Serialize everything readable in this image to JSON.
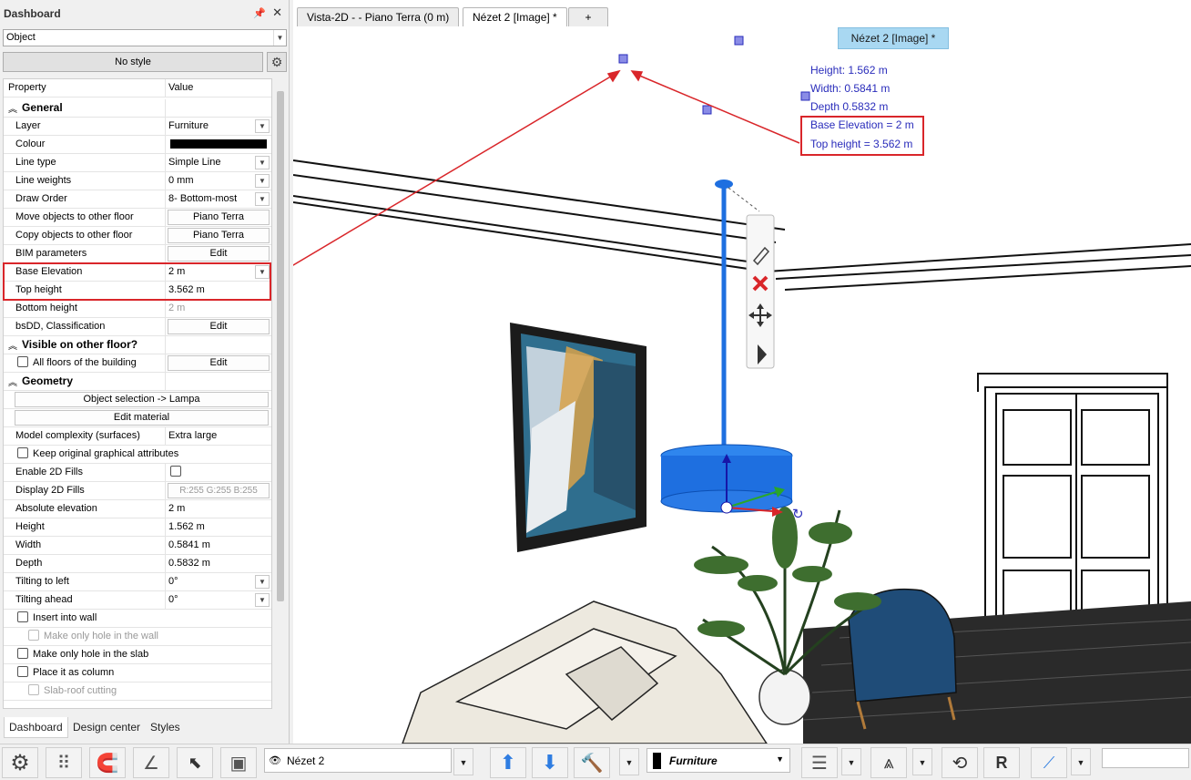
{
  "panel": {
    "title": "Dashboard",
    "selector": "Object",
    "style_button": "No style",
    "header": {
      "property": "Property",
      "value": "Value"
    },
    "sections": {
      "general": "General",
      "visible": "Visible on other floor?",
      "geometry": "Geometry"
    },
    "rows": {
      "layer": {
        "k": "Layer",
        "v": "Furniture"
      },
      "colour": {
        "k": "Colour"
      },
      "line_type": {
        "k": "Line type",
        "v": "Simple Line"
      },
      "line_weights": {
        "k": "Line weights",
        "v": "0 mm"
      },
      "draw_order": {
        "k": "Draw Order",
        "v": "8- Bottom-most"
      },
      "move_objects": {
        "k": "Move objects to other floor",
        "v": "Piano Terra"
      },
      "copy_objects": {
        "k": "Copy objects to other floor",
        "v": "Piano Terra"
      },
      "bim": {
        "k": "BIM parameters",
        "v": "Edit"
      },
      "base_elevation": {
        "k": "Base Elevation",
        "v": "2 m"
      },
      "top_height": {
        "k": "Top height",
        "v": "3.562 m"
      },
      "bottom_height": {
        "k": "Bottom height",
        "v": "2 m"
      },
      "bsdd": {
        "k": "bsDD, Classification",
        "v": "Edit"
      },
      "all_floors": {
        "k": "All floors of the building",
        "v": "Edit"
      },
      "object_selection": "Object selection -> Lampa",
      "edit_material": "Edit material",
      "model_complexity": {
        "k": "Model complexity (surfaces)",
        "v": "Extra large"
      },
      "keep_graphical": "Keep original graphical attributes",
      "enable_2d_fills": {
        "k": "Enable 2D Fills"
      },
      "display_2d_fills": {
        "k": "Display 2D Fills",
        "v": "R:255 G:255 B:255"
      },
      "absolute_elevation": {
        "k": "Absolute elevation",
        "v": "2 m"
      },
      "height": {
        "k": "Height",
        "v": "1.562 m"
      },
      "width": {
        "k": "Width",
        "v": "0.5841 m"
      },
      "depth": {
        "k": "Depth",
        "v": "0.5832 m"
      },
      "tilting_left": {
        "k": "Tilting to left",
        "v": "0°"
      },
      "tilting_ahead": {
        "k": "Tilting ahead",
        "v": "0°"
      },
      "insert_wall": "Insert into wall",
      "hole_wall": "Make only hole in the wall",
      "hole_slab": "Make only hole in the slab",
      "place_column": "Place it as column",
      "slab_roof": "Slab-roof cutting"
    },
    "tabs": [
      "Dashboard",
      "Design center",
      "Styles"
    ]
  },
  "doc_tabs": [
    "Vista-2D -  - Piano Terra (0 m)",
    "Nézet 2 [Image] *",
    "+"
  ],
  "view_label": "Nézet 2 [Image] *",
  "info": {
    "height": "Height: 1.562 m",
    "width": "Width: 0.5841 m",
    "depth": "Depth 0.5832 m",
    "base_elevation": "Base Elevation = 2 m",
    "top_height": "Top height = 3.562 m"
  },
  "toolbar": {
    "view_select": "Nézet 2",
    "layer_select": "Furniture"
  },
  "colors": {
    "highlight_red": "#d9262a",
    "info_blue": "#2a2dbb",
    "lamp_blue": "#1e6fe0",
    "view_label_bg": "#a9d8f2"
  }
}
